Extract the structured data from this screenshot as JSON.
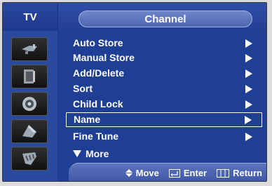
{
  "header": {
    "tv_label": "TV",
    "title": "Channel"
  },
  "sidebar": {
    "icons": [
      "antenna-icon",
      "display-icon",
      "speaker-icon",
      "setup-icon",
      "input-icon"
    ]
  },
  "menu": {
    "items": [
      {
        "label": "Auto Store",
        "has_arrow": true
      },
      {
        "label": "Manual Store",
        "has_arrow": true
      },
      {
        "label": "Add/Delete",
        "has_arrow": true
      },
      {
        "label": "Sort",
        "has_arrow": true
      },
      {
        "label": "Child Lock",
        "has_arrow": true
      },
      {
        "label": "Name",
        "has_arrow": true,
        "selected": true
      },
      {
        "label": "Fine Tune",
        "has_arrow": true
      }
    ],
    "more_label": "More"
  },
  "footer": {
    "move_label": "Move",
    "enter_label": "Enter",
    "return_label": "Return"
  },
  "colors": {
    "background": "#1f3f94",
    "selected_border": "#ffffff"
  }
}
